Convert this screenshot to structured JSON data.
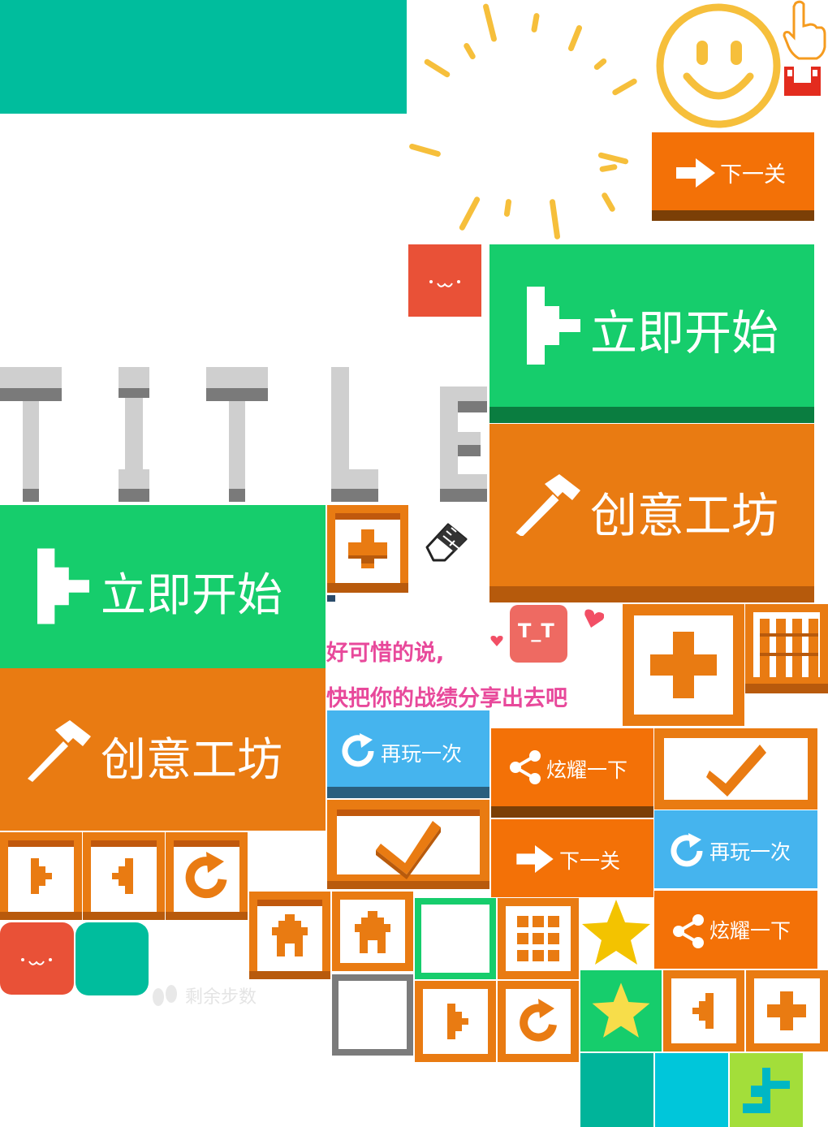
{
  "colors": {
    "teal": "#00bd9d",
    "green": "#16cd6c",
    "green_dark": "#0a7d40",
    "orange": "#e97b12",
    "orange_bright": "#f37107",
    "orange_dark": "#7b3f06",
    "blue": "#45b4ee",
    "blue_dark": "#2a5f7e",
    "red": "#e95137",
    "pink_text": "#e8499b",
    "sun": "#f6bf3b",
    "star": "#f3c300"
  },
  "buttons": {
    "next_level": "下一关",
    "start_now": "立即开始",
    "workshop": "创意工坊",
    "play_again": "再玩一次",
    "show_off": "炫耀一下"
  },
  "title_letters": [
    "T",
    "I",
    "T",
    "L",
    "E"
  ],
  "fail_message": {
    "line1": "好可惜的说,",
    "line2": "快把你的战绩分享出去吧",
    "face_badge": "T_T"
  },
  "steps_label": "剩余步数",
  "icons": [
    "pointing-hand-icon",
    "smiley-sun-icon",
    "arrow-right-icon",
    "play-icon",
    "hammer-icon",
    "plus-icon",
    "eraser-icon",
    "heart-icon",
    "grid-icon",
    "check-icon",
    "rotate-icon",
    "home-icon",
    "star-icon",
    "back-icon",
    "share-icon",
    "footprint-icon"
  ]
}
